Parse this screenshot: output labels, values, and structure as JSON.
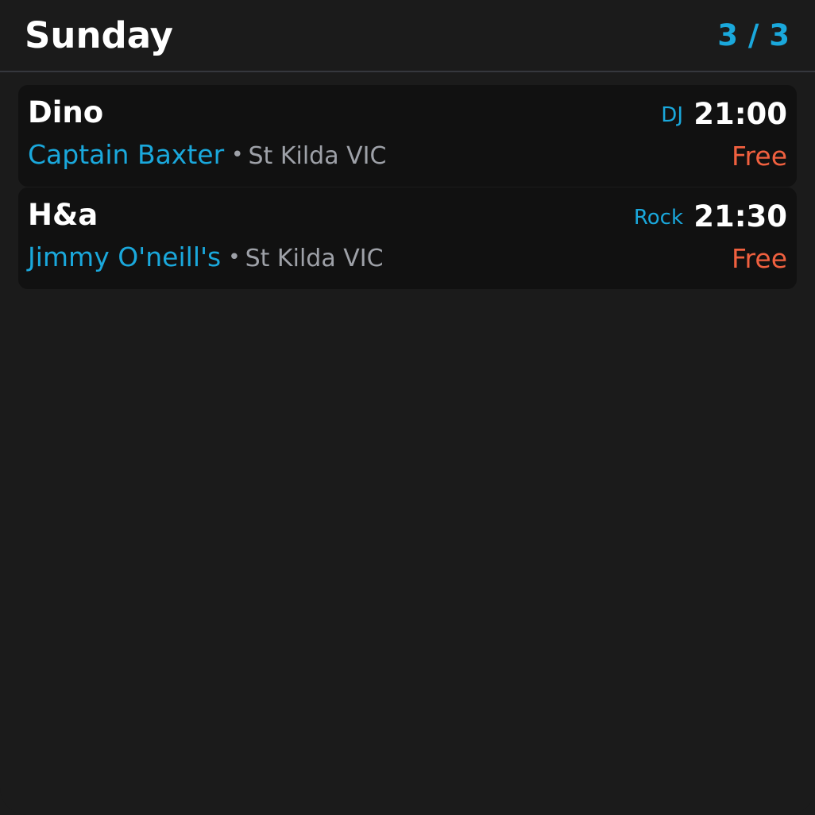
{
  "colors": {
    "background": "#1b1b1b",
    "card": "#111111",
    "divider": "#35373d",
    "accent": "#1aa8dc",
    "muted": "#9ea1a8",
    "price": "#f0603f",
    "text": "#ffffff"
  },
  "header": {
    "day": "Sunday",
    "page_indicator": "3 / 3"
  },
  "gigs": [
    {
      "artist": "Dino",
      "genre": "DJ",
      "time": "21:00",
      "venue": "Captain Baxter",
      "separator": "•",
      "suburb": "St Kilda VIC",
      "price": "Free"
    },
    {
      "artist": "H&a",
      "genre": "Rock",
      "time": "21:30",
      "venue": "Jimmy O'neill's",
      "separator": "•",
      "suburb": "St Kilda VIC",
      "price": "Free"
    }
  ]
}
